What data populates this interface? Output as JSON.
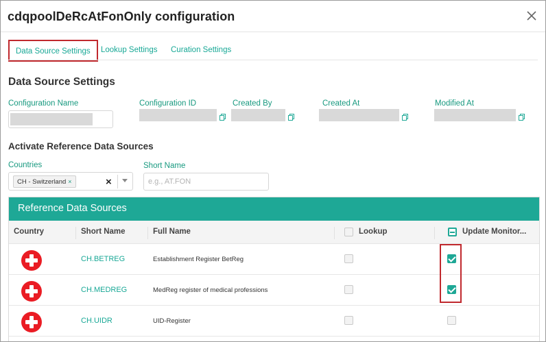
{
  "dialog": {
    "title": "cdqpoolDeRcAtFonOnly configuration",
    "close_icon": "close-icon"
  },
  "tabs": [
    {
      "label": "Data Source Settings",
      "active": true
    },
    {
      "label": "Lookup Settings",
      "active": false
    },
    {
      "label": "Curation Settings",
      "active": false
    }
  ],
  "section": {
    "title": "Data Source Settings"
  },
  "fields": {
    "configuration_name": {
      "label": "Configuration Name"
    },
    "configuration_id": {
      "label": "Configuration ID"
    },
    "created_by": {
      "label": "Created By"
    },
    "created_at": {
      "label": "Created At"
    },
    "modified_at": {
      "label": "Modified At"
    }
  },
  "activate": {
    "title": "Activate Reference Data Sources",
    "countries_label": "Countries",
    "country_chip": "CH - Switzerland",
    "chip_remove": "×",
    "clear_icon": "×",
    "short_name_label": "Short Name",
    "short_name_placeholder": "e.g., AT.FON"
  },
  "table": {
    "title": "Reference Data Sources",
    "headers": {
      "country": "Country",
      "short_name": "Short Name",
      "full_name": "Full Name",
      "lookup": "Lookup",
      "update_monitor": "Update Monitor..."
    },
    "rows": [
      {
        "country_icon": "swiss-flag-icon",
        "short_name": "CH.BETREG",
        "full_name": "Establishment Register BetReg",
        "lookup": false,
        "update_monitor": true
      },
      {
        "country_icon": "swiss-flag-icon",
        "short_name": "CH.MEDREG",
        "full_name": "MedReg register of medical professions",
        "lookup": false,
        "update_monitor": true
      },
      {
        "country_icon": "swiss-flag-icon",
        "short_name": "CH.UIDR",
        "full_name": "UID-Register",
        "lookup": false,
        "update_monitor": false
      }
    ]
  },
  "colors": {
    "accent": "#1ea896",
    "highlight": "#c0282d",
    "flag_red": "#ea1c24"
  }
}
